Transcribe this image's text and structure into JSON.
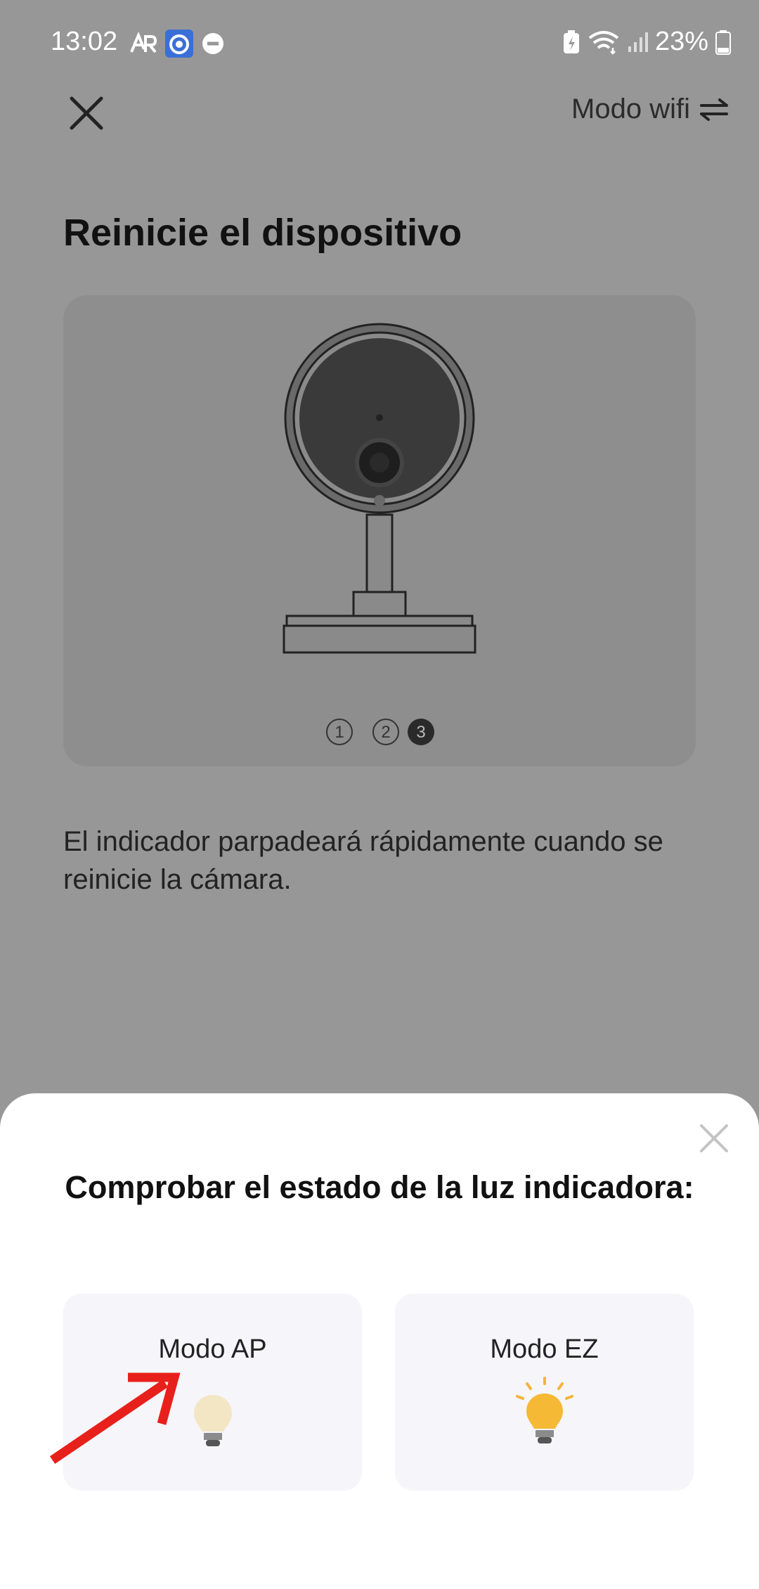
{
  "status_bar": {
    "time": "13:02",
    "battery_percent": "23%",
    "icons": [
      "ar-icon",
      "vpn-icon",
      "dnd-icon",
      "battery-saver-icon",
      "wifi-icon",
      "signal-icon",
      "battery-icon"
    ]
  },
  "top_bar": {
    "close_icon": "close-icon",
    "mode_switch_label": "Modo wifi",
    "mode_switch_icon": "swap-icon"
  },
  "page": {
    "title": "Reinicie el dispositivo",
    "illustration": {
      "subject": "camera-illustration",
      "steps": [
        "1",
        "2",
        "3"
      ],
      "active_step": 3
    },
    "description": "El indicador parpadeará rápidamente cuando se reinicie la cámara."
  },
  "sheet": {
    "title": "Comprobar el estado de la luz indicadora:",
    "close_icon": "close-icon",
    "modes": [
      {
        "label": "Modo AP",
        "icon": "bulb-dim-icon"
      },
      {
        "label": "Modo EZ",
        "icon": "bulb-lit-icon"
      }
    ]
  },
  "colors": {
    "overlay_bg": "#979797",
    "sheet_bg": "#ffffff",
    "card_bg": "#f5f5fa",
    "annotation_arrow": "#e8201b"
  }
}
